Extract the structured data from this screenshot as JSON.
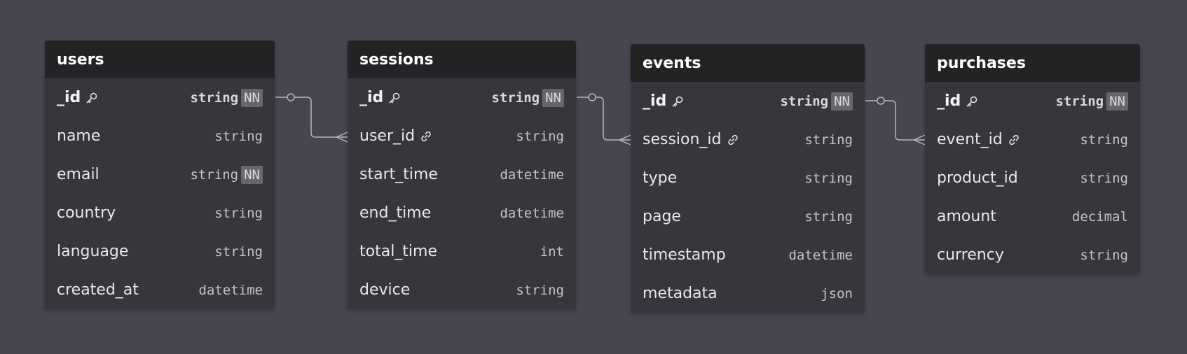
{
  "tables": [
    {
      "name": "users",
      "fields": [
        {
          "name": "_id",
          "type": "string",
          "nn": true,
          "pk": true
        },
        {
          "name": "name",
          "type": "string"
        },
        {
          "name": "email",
          "type": "string",
          "nn": true
        },
        {
          "name": "country",
          "type": "string"
        },
        {
          "name": "language",
          "type": "string"
        },
        {
          "name": "created_at",
          "type": "datetime"
        }
      ]
    },
    {
      "name": "sessions",
      "fields": [
        {
          "name": "_id",
          "type": "string",
          "nn": true,
          "pk": true
        },
        {
          "name": "user_id",
          "type": "string",
          "fk": true
        },
        {
          "name": "start_time",
          "type": "datetime"
        },
        {
          "name": "end_time",
          "type": "datetime"
        },
        {
          "name": "total_time",
          "type": "int"
        },
        {
          "name": "device",
          "type": "string"
        }
      ]
    },
    {
      "name": "events",
      "fields": [
        {
          "name": "_id",
          "type": "string",
          "nn": true,
          "pk": true
        },
        {
          "name": "session_id",
          "type": "string",
          "fk": true
        },
        {
          "name": "type",
          "type": "string"
        },
        {
          "name": "page",
          "type": "string"
        },
        {
          "name": "timestamp",
          "type": "datetime"
        },
        {
          "name": "metadata",
          "type": "json"
        }
      ]
    },
    {
      "name": "purchases",
      "fields": [
        {
          "name": "_id",
          "type": "string",
          "nn": true,
          "pk": true
        },
        {
          "name": "event_id",
          "type": "string",
          "fk": true
        },
        {
          "name": "product_id",
          "type": "string"
        },
        {
          "name": "amount",
          "type": "decimal"
        },
        {
          "name": "currency",
          "type": "string"
        }
      ]
    }
  ],
  "nn_label": "NN",
  "relations": [
    {
      "from": "users._id",
      "to": "sessions.user_id",
      "cardinality": "one-to-many"
    },
    {
      "from": "sessions._id",
      "to": "events.session_id",
      "cardinality": "one-to-many"
    },
    {
      "from": "events._id",
      "to": "purchases.event_id",
      "cardinality": "one-to-many"
    }
  ],
  "colors": {
    "background": "#46464f",
    "table_body": "#36363d",
    "table_header": "#232326",
    "connector": "#b5b5bb",
    "nn_badge": "#66666c"
  },
  "icons": {
    "primary_key": "key-icon",
    "foreign_key": "link-icon"
  }
}
